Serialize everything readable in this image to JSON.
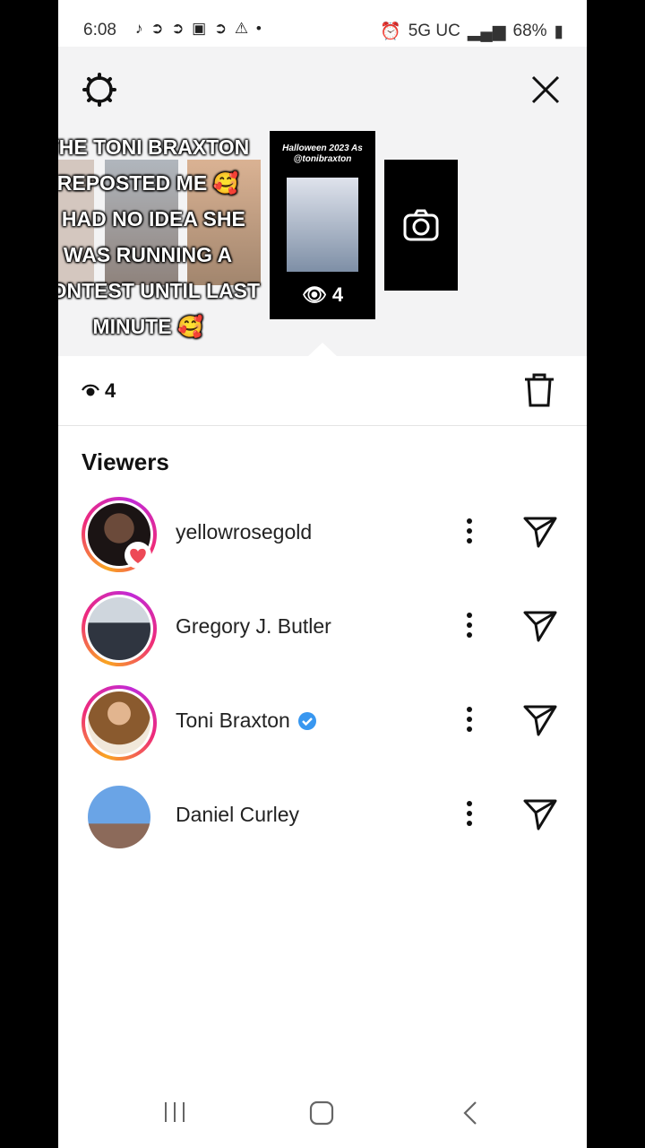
{
  "status_bar": {
    "time": "6:08",
    "network": "5G UC",
    "battery": "68%"
  },
  "story_strip": {
    "caption_lines": [
      "THE TONI BRAXTON",
      "REPOSTED ME 🥰",
      "I HAD NO IDEA SHE",
      "WAS RUNNING A",
      "CONTEST UNTIL LAST",
      "MINUTE 🥰"
    ],
    "selected_title": "Halloween 2023 As @tonibraxton",
    "selected_views": "4"
  },
  "stats": {
    "view_count": "4"
  },
  "viewers": {
    "title": "Viewers",
    "items": [
      {
        "name": "yellowrosegold",
        "ring": true,
        "liked": true,
        "verified": false
      },
      {
        "name": "Gregory J. Butler",
        "ring": true,
        "liked": false,
        "verified": false
      },
      {
        "name": "Toni Braxton",
        "ring": true,
        "liked": false,
        "verified": true
      },
      {
        "name": "Daniel Curley",
        "ring": false,
        "liked": false,
        "verified": false
      }
    ]
  },
  "colors": {
    "accent_ring_start": "#f9a521",
    "accent_ring_end": "#c22ad6",
    "verified_blue": "#3897f0",
    "heart_red": "#ed4956"
  },
  "icons": [
    "gear-icon",
    "close-icon",
    "camera-icon",
    "eye-icon",
    "trash-icon",
    "more-icon",
    "send-icon",
    "heart-icon",
    "verified-icon"
  ]
}
